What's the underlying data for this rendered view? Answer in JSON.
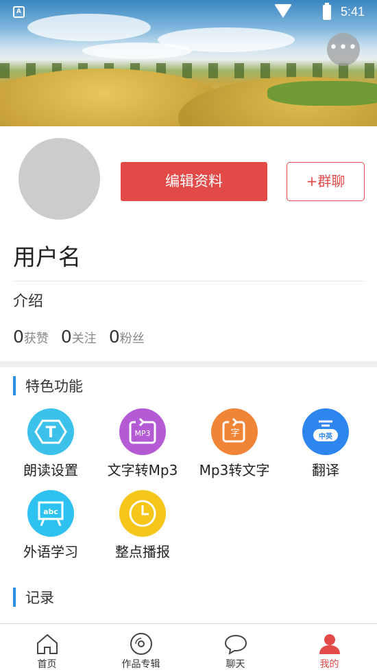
{
  "status_bar": {
    "time": "5:41",
    "app_badge": "A"
  },
  "header": {
    "more_button_icon": "more-horizontal-icon",
    "more_label": "•••"
  },
  "profile": {
    "edit_button": "编辑资料",
    "group_chat_button": "+群聊",
    "username": "用户名",
    "intro": "介绍",
    "stats": [
      {
        "count": "0",
        "label": "获赞"
      },
      {
        "count": "0",
        "label": "关注"
      },
      {
        "count": "0",
        "label": "粉丝"
      }
    ]
  },
  "features_section": {
    "title": "特色功能",
    "items": [
      {
        "label": "朗读设置",
        "icon": "text-hexagon-icon",
        "color": "#3cc1ea",
        "glyph": "T"
      },
      {
        "label": "文字转Mp3",
        "icon": "text-to-mp3-icon",
        "color": "#b45ad4",
        "glyph": "MP3"
      },
      {
        "label": "Mp3转文字",
        "icon": "mp3-to-text-icon",
        "color": "#f08538",
        "glyph": "字"
      },
      {
        "label": "翻译",
        "icon": "translate-icon",
        "color": "#2d86ee",
        "glyph": "中英"
      },
      {
        "label": "外语学习",
        "icon": "blackboard-abc-icon",
        "color": "#2ec2f0",
        "glyph": "abc"
      },
      {
        "label": "整点播报",
        "icon": "clock-icon",
        "color": "#f5c518",
        "glyph": ""
      }
    ]
  },
  "records_section": {
    "title": "记录"
  },
  "bottom_nav": {
    "items": [
      {
        "label": "首页",
        "icon": "home-icon"
      },
      {
        "label": "作品专辑",
        "icon": "disc-icon"
      },
      {
        "label": "聊天",
        "icon": "chat-bubble-icon"
      },
      {
        "label": "我的",
        "icon": "user-icon"
      }
    ],
    "active_index": 3,
    "accent_color": "#e24a47"
  }
}
